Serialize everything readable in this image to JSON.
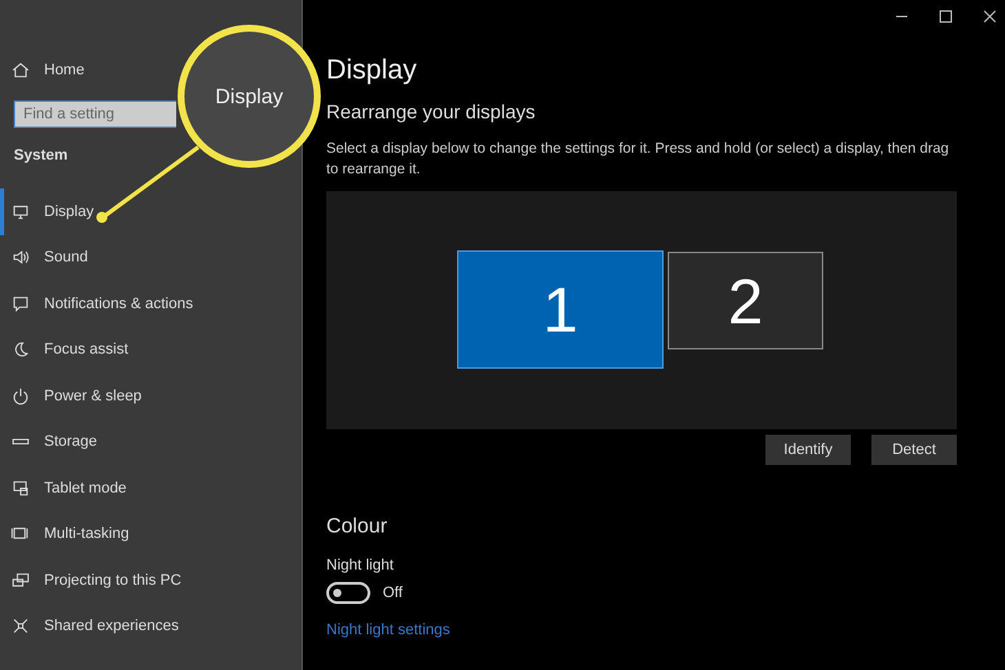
{
  "sidebar": {
    "home": "Home",
    "search": {
      "placeholder": "Find a setting"
    },
    "section": "System",
    "items": [
      {
        "label": "Display",
        "selected": true
      },
      {
        "label": "Sound",
        "selected": false
      },
      {
        "label": "Notifications & actions",
        "selected": false
      },
      {
        "label": "Focus assist",
        "selected": false
      },
      {
        "label": "Power & sleep",
        "selected": false
      },
      {
        "label": "Storage",
        "selected": false
      },
      {
        "label": "Tablet mode",
        "selected": false
      },
      {
        "label": "Multi-tasking",
        "selected": false
      },
      {
        "label": "Projecting to this PC",
        "selected": false
      },
      {
        "label": "Shared experiences",
        "selected": false
      }
    ]
  },
  "callout": {
    "label": "Display"
  },
  "page": {
    "title": "Display",
    "subtitle": "Rearrange your displays",
    "description": "Select a display below to change the settings for it. Press and hold (or select) a display, then drag to rearrange it.",
    "monitors": [
      {
        "label": "1",
        "selected": true
      },
      {
        "label": "2",
        "selected": false
      }
    ],
    "buttons": [
      "Identify",
      "Detect"
    ],
    "colour": {
      "heading": "Colour",
      "night_light": {
        "label": "Night light",
        "on": false,
        "state_text": "Off"
      },
      "link": "Night light settings"
    }
  }
}
